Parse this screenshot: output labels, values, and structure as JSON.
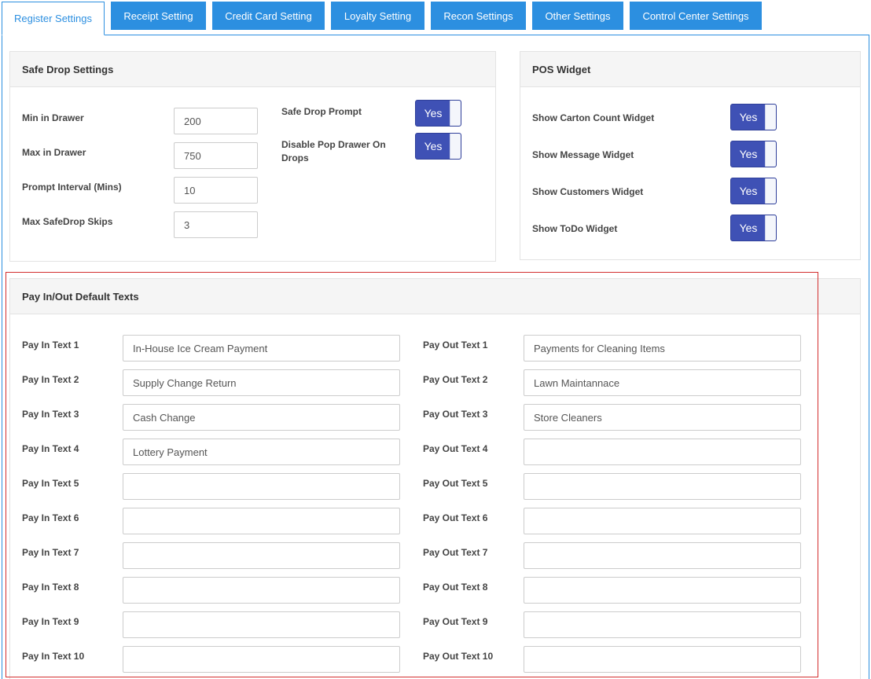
{
  "tabs": [
    {
      "label": "Register Settings",
      "active": true
    },
    {
      "label": "Receipt Setting"
    },
    {
      "label": "Credit Card Setting"
    },
    {
      "label": "Loyalty Setting"
    },
    {
      "label": "Recon Settings"
    },
    {
      "label": "Other Settings"
    },
    {
      "label": "Control Center Settings"
    }
  ],
  "safe_drop": {
    "title": "Safe Drop Settings",
    "fields": [
      {
        "label": "Min in Drawer",
        "value": "200"
      },
      {
        "label": "Max in Drawer",
        "value": "750"
      },
      {
        "label": "Prompt Interval (Mins)",
        "value": "10"
      },
      {
        "label": "Max SafeDrop Skips",
        "value": "3"
      }
    ],
    "toggles": [
      {
        "label": "Safe Drop Prompt",
        "state": "Yes"
      },
      {
        "label": "Disable Pop Drawer On Drops",
        "state": "Yes"
      }
    ]
  },
  "pos_widget": {
    "title": "POS Widget",
    "toggles": [
      {
        "label": "Show Carton Count Widget",
        "state": "Yes"
      },
      {
        "label": "Show Message Widget",
        "state": "Yes"
      },
      {
        "label": "Show Customers Widget",
        "state": "Yes"
      },
      {
        "label": "Show ToDo Widget",
        "state": "Yes"
      }
    ]
  },
  "pay_texts": {
    "title": "Pay In/Out Default Texts",
    "pay_in": [
      {
        "label": "Pay In Text 1",
        "value": "In-House Ice Cream Payment"
      },
      {
        "label": "Pay In Text 2",
        "value": "Supply Change Return"
      },
      {
        "label": "Pay In Text 3",
        "value": "Cash Change"
      },
      {
        "label": "Pay In Text 4",
        "value": "Lottery Payment"
      },
      {
        "label": "Pay In Text 5",
        "value": ""
      },
      {
        "label": "Pay In Text 6",
        "value": ""
      },
      {
        "label": "Pay In Text 7",
        "value": ""
      },
      {
        "label": "Pay In Text 8",
        "value": ""
      },
      {
        "label": "Pay In Text 9",
        "value": ""
      },
      {
        "label": "Pay In Text 10",
        "value": ""
      }
    ],
    "pay_out": [
      {
        "label": "Pay Out Text 1",
        "value": "Payments for Cleaning Items"
      },
      {
        "label": "Pay Out Text 2",
        "value": "Lawn Maintannace"
      },
      {
        "label": "Pay Out Text 3",
        "value": "Store Cleaners"
      },
      {
        "label": "Pay Out Text 4",
        "value": ""
      },
      {
        "label": "Pay Out Text 5",
        "value": ""
      },
      {
        "label": "Pay Out Text 6",
        "value": ""
      },
      {
        "label": "Pay Out Text 7",
        "value": ""
      },
      {
        "label": "Pay Out Text 8",
        "value": ""
      },
      {
        "label": "Pay Out Text 9",
        "value": ""
      },
      {
        "label": "Pay Out Text 10",
        "value": ""
      }
    ]
  },
  "colors": {
    "tab_blue": "#2c8fe0",
    "toggle_blue": "#3f51b5",
    "highlight_red": "#d32f2f"
  }
}
